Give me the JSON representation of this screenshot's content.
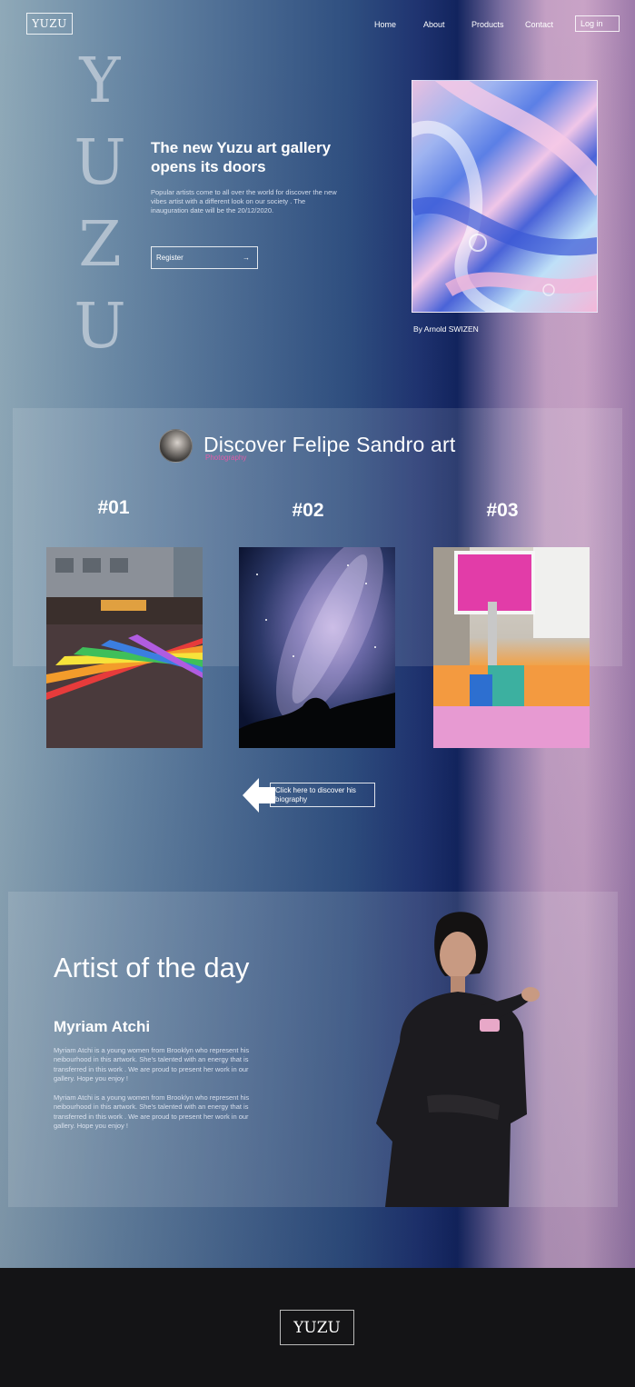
{
  "brand": {
    "logo": "YUZU",
    "vertical_letters": [
      "Y",
      "U",
      "Z",
      "U"
    ]
  },
  "nav": {
    "items": [
      "Home",
      "About",
      "Products",
      "Contact"
    ],
    "login": "Log in"
  },
  "hero": {
    "title": "The new Yuzu art gallery opens its doors",
    "text": "Popular artists come to all over the world for discover the new vibes artist with a different look on our society . The inauguration date will be the 20/12/2020.",
    "register": "Register",
    "register_arrow": "→",
    "caption": "By Arnold SWIZEN"
  },
  "discover": {
    "title": "Discover Felipe Sandro art",
    "subtitle": "Photography",
    "items": [
      {
        "label": "#01"
      },
      {
        "label": "#02"
      },
      {
        "label": "#03"
      }
    ],
    "bio_link": "Click here to discover his biography"
  },
  "artist": {
    "heading": "Artist of the day",
    "name": "Myriam Atchi",
    "bio_1": "Myriam Atchi is a young women from Brooklyn  who represent his neibourhood in this artwork. She's talented with an energy  that is transferred in this work . We are proud to present her work in our gallery. Hope you enjoy !",
    "bio_2": "Myriam Atchi is a young women from Brooklyn  who represent his neibourhood in this artwork. She's talented with an energy  that is transferred in this work . We are proud to present her work in our gallery. Hope you enjoy !"
  },
  "footer": {
    "logo": "YUZU"
  },
  "colors": {
    "accent_pink": "#e05ca8",
    "footer_bg": "#141416"
  }
}
